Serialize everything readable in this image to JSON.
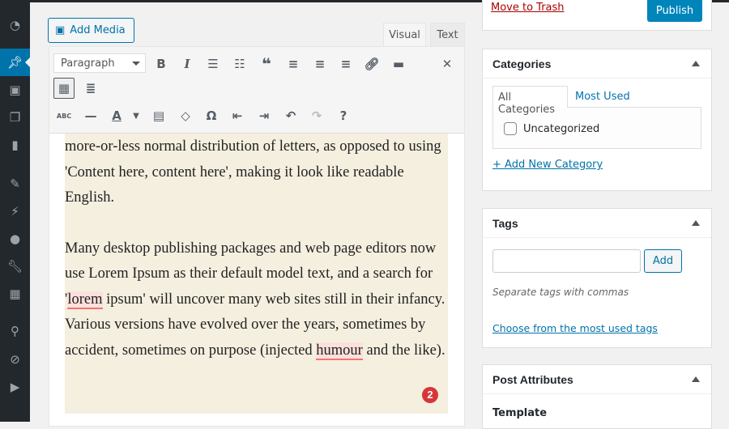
{
  "sidebar": {
    "icons": [
      "dashboard-icon",
      "posts-icon",
      "media-icon",
      "pages-icon",
      "comments-icon",
      "appearance-icon",
      "plugins-icon",
      "users-icon",
      "tools-icon",
      "settings-icon",
      "location-icon",
      "edit-icon",
      "play-icon"
    ],
    "active": "posts-icon"
  },
  "editor": {
    "add_media": "Add Media",
    "tab_visual": "Visual",
    "tab_text": "Text",
    "format": "Paragraph",
    "p1": "more-or-less normal distribution of letters, as opposed to using 'Content here, content here', making it look like readable English.",
    "p2a": "Many desktop publishing packages and web page editors now use Lorem Ipsum as their default model text, and a search for '",
    "p2_lorem": "lorem",
    "p2b": " ipsum' will uncover many web sites still in their infancy. Various versions have evolved over the years, sometimes by accident, sometimes on purpose (injected ",
    "p2_humour": "humour",
    "p2c": " and the like).",
    "badge": "2"
  },
  "publish": {
    "trash": "Move to Trash",
    "publish": "Publish"
  },
  "categories": {
    "title": "Categories",
    "tab_all": "All Categories",
    "tab_most": "Most Used",
    "items": [
      "Uncategorized"
    ],
    "add_new": "+ Add New Category"
  },
  "tags": {
    "title": "Tags",
    "input_value": "",
    "add": "Add",
    "hint": "Separate tags with commas",
    "choose": "Choose from the most used tags"
  },
  "attributes": {
    "title": "Post Attributes",
    "template": "Template"
  },
  "colors": {
    "accent": "#0073aa",
    "menu_bg": "#23282d",
    "trash": "#a00",
    "highlight": "#f5efe0",
    "badge": "#d63638"
  }
}
